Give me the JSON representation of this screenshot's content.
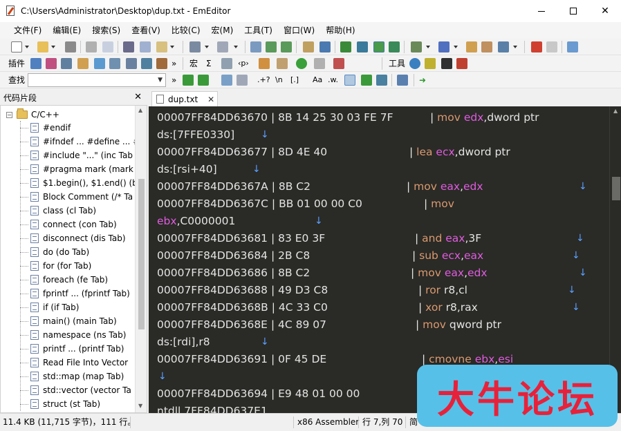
{
  "window": {
    "title": "C:\\Users\\Administrator\\Desktop\\dup.txt - EmEditor"
  },
  "menu": [
    {
      "label": "文件(F)"
    },
    {
      "label": "编辑(E)"
    },
    {
      "label": "搜索(S)"
    },
    {
      "label": "查看(V)"
    },
    {
      "label": "比较(C)"
    },
    {
      "label": "宏(M)"
    },
    {
      "label": "工具(T)"
    },
    {
      "label": "窗口(W)"
    },
    {
      "label": "帮助(H)"
    }
  ],
  "toolbars": {
    "plugins_label": "插件",
    "macro_label": "宏",
    "macro_sigma": "Σ",
    "macro_tag": "‹p›",
    "tools_label": "工具",
    "find_label": "查找",
    "find_value": "",
    "find_more": "»",
    "regex_label": ".+?",
    "newline_label": "\\n",
    "bracket_label": "[.]",
    "case_label": "Aa",
    "word_label": ".w."
  },
  "sidebar": {
    "title": "代码片段",
    "root_label": "C/C++",
    "items": [
      {
        "label": "#endif"
      },
      {
        "label": "#ifndef ... #define ... #"
      },
      {
        "label": "#include \"...\"  (inc Tab"
      },
      {
        "label": "#pragma mark  (mark"
      },
      {
        "label": "$1.begin(), $1.end()  (b"
      },
      {
        "label": "Block Comment  (/* Ta"
      },
      {
        "label": "class  (cl Tab)"
      },
      {
        "label": "connect  (con Tab)"
      },
      {
        "label": "disconnect  (dis Tab)"
      },
      {
        "label": "do  (do Tab)"
      },
      {
        "label": "for  (for Tab)"
      },
      {
        "label": "foreach  (fe Tab)"
      },
      {
        "label": "fprintf ...  (fprintf Tab)"
      },
      {
        "label": "if  (if Tab)"
      },
      {
        "label": "main()  (main Tab)"
      },
      {
        "label": "namespace  (ns Tab)"
      },
      {
        "label": "printf ...  (printf Tab)"
      },
      {
        "label": "Read File Into Vector"
      },
      {
        "label": "std::map  (map Tab)"
      },
      {
        "label": "std::vector  (vector Ta"
      },
      {
        "label": "struct  (st Tab)"
      }
    ]
  },
  "tab": {
    "label": "dup.txt"
  },
  "editor_lines": [
    {
      "addr": "00007FF84DD63670 | 8B 14 25 30 03 FE 7F",
      "mn": "mov",
      "op": [
        {
          "t": "edx",
          "r": true
        },
        {
          "t": ",dword ptr",
          "r": false
        }
      ],
      "nl": ""
    },
    {
      "addr": "ds:[7FFE0330]",
      "mn": "",
      "op": [],
      "nl": "↓"
    },
    {
      "addr": "00007FF84DD63677 | 8D 4E 40",
      "mn": "lea",
      "op": [
        {
          "t": "ecx",
          "r": true
        },
        {
          "t": ",dword ptr",
          "r": false
        }
      ],
      "nl": ""
    },
    {
      "addr": "ds:[rsi+40]",
      "mn": "",
      "op": [],
      "nl": "↓"
    },
    {
      "addr": "00007FF84DD6367A | 8B C2",
      "mn": "mov",
      "op": [
        {
          "t": "eax",
          "r": true
        },
        {
          "t": ",",
          "r": false
        },
        {
          "t": "edx",
          "r": true
        }
      ],
      "nl": "↓"
    },
    {
      "addr": "00007FF84DD6367C | BB 01 00 00 C0",
      "mn": "mov",
      "op": [],
      "nl": ""
    },
    {
      "addr": "",
      "pre": "ebx",
      "post": ",C0000001",
      "mn": "",
      "op": [],
      "nl": "↓"
    },
    {
      "addr": "00007FF84DD63681 | 83 E0 3F",
      "mn": "and",
      "op": [
        {
          "t": "eax",
          "r": true
        },
        {
          "t": ",3F",
          "r": false
        }
      ],
      "nl": "↓"
    },
    {
      "addr": "00007FF84DD63684 | 2B C8",
      "mn": "sub",
      "op": [
        {
          "t": "ecx",
          "r": true
        },
        {
          "t": ",",
          "r": false
        },
        {
          "t": "eax",
          "r": true
        }
      ],
      "nl": "↓"
    },
    {
      "addr": "00007FF84DD63686 | 8B C2",
      "mn": "mov",
      "op": [
        {
          "t": "eax",
          "r": true
        },
        {
          "t": ",",
          "r": false
        },
        {
          "t": "edx",
          "r": true
        }
      ],
      "nl": "↓"
    },
    {
      "addr": "00007FF84DD63688 | 49 D3 C8",
      "mn": "ror",
      "op": [
        {
          "t": " r8,cl",
          "r": false
        }
      ],
      "nl": "↓"
    },
    {
      "addr": "00007FF84DD6368B | 4C 33 C0",
      "mn": "xor",
      "op": [
        {
          "t": " r8,rax",
          "r": false
        }
      ],
      "nl": "↓"
    },
    {
      "addr": "00007FF84DD6368E | 4C 89 07",
      "mn": "mov",
      "op": [
        {
          "t": " qword ptr",
          "r": false
        }
      ],
      "nl": ""
    },
    {
      "addr": "ds:[rdi],r8",
      "mn": "",
      "op": [],
      "nl": "↓"
    },
    {
      "addr": "00007FF84DD63691 | 0F 45 DE",
      "mn": "cmovne",
      "op": [
        {
          "t": " ebx",
          "r": true
        },
        {
          "t": ",",
          "r": false
        },
        {
          "t": "esi",
          "r": true
        }
      ],
      "nl": ""
    },
    {
      "addr": "",
      "mn": "",
      "op": [],
      "nl": "↓"
    },
    {
      "addr": "00007FF84DD63694 | E9 48 01 00 00",
      "mn": "",
      "op": [],
      "nl": ""
    },
    {
      "addr": "ntdll.7FF84DD637E1",
      "mn": "",
      "op": [],
      "nl": ""
    }
  ],
  "status": {
    "size": "11.4 KB (11,715 字节)，111 行。",
    "syntax": "x86 Assembler",
    "position": "行 7,列 70",
    "encoding": "简"
  },
  "watermark": {
    "text": "大牛论坛"
  },
  "colors": {
    "editor_bg": "#2a2a26",
    "mnemonic": "#d99a70",
    "register": "#e05ce0",
    "newline_mark": "#5aa0ff",
    "watermark_bg": "#57c0e8",
    "watermark_text": "#e8213a"
  }
}
